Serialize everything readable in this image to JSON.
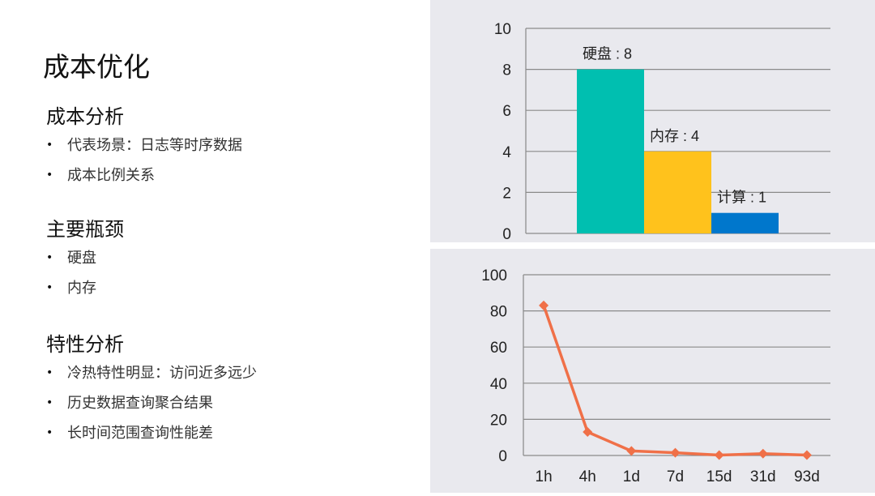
{
  "slide": {
    "title": "成本优化",
    "sections": [
      {
        "heading": "成本分析",
        "bullets": [
          "代表场景：日志等时序数据",
          "成本比例关系"
        ]
      },
      {
        "heading": "主要瓶颈",
        "bullets": [
          "硬盘",
          "内存"
        ]
      },
      {
        "heading": "特性分析",
        "bullets": [
          "冷热特性明显：访问近多远少",
          "历史数据查询聚合结果",
          "长时间范围查询性能差"
        ]
      }
    ],
    "bullet_glyph": "•"
  },
  "chart_data": [
    {
      "type": "bar",
      "title": "",
      "xlabel": "",
      "ylabel": "",
      "categories": [
        "硬盘",
        "内存",
        "计算"
      ],
      "values": [
        8,
        4,
        1
      ],
      "data_labels": [
        "硬盘 : 8",
        "内存 : 4",
        "计算 : 1"
      ],
      "colors": [
        "#00bfb0",
        "#ffc21c",
        "#0077cc"
      ],
      "ylim": [
        0,
        10
      ],
      "yticks": [
        0,
        2,
        4,
        6,
        8,
        10
      ],
      "grid": true,
      "legend": "none"
    },
    {
      "type": "line",
      "title": "",
      "xlabel": "",
      "ylabel": "",
      "categories": [
        "1h",
        "4h",
        "1d",
        "7d",
        "15d",
        "31d",
        "93d"
      ],
      "values": [
        83,
        13,
        2.5,
        1.5,
        0.2,
        1,
        0.2
      ],
      "color": "#f07048",
      "marker": "diamond",
      "ylim": [
        0,
        100
      ],
      "yticks": [
        0,
        20,
        40,
        60,
        80,
        100
      ],
      "grid": true,
      "legend": "none"
    }
  ]
}
